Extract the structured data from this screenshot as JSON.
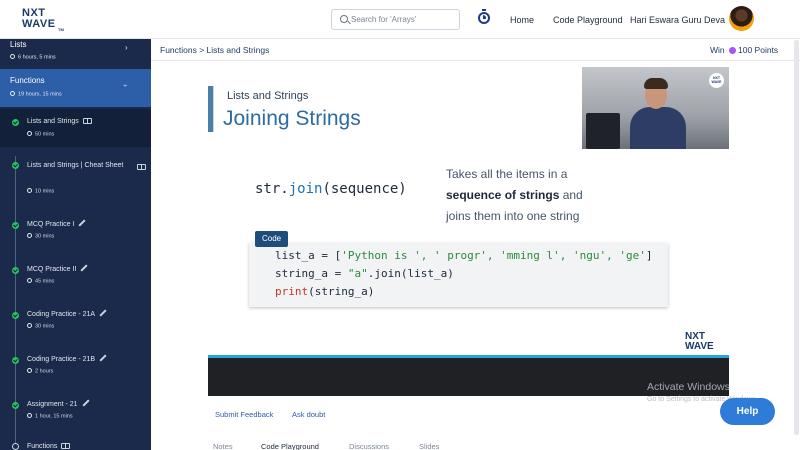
{
  "header": {
    "logo_line1": "NXT",
    "logo_line2": "WAVE",
    "logo_tm": "TM",
    "search_placeholder": "Search for 'Arrays'",
    "nav": [
      "Home",
      "Code Playground"
    ],
    "user_name": "Hari Eswara Guru Deva"
  },
  "sidebar": {
    "lists": {
      "title": "Lists",
      "meta": "6 hours, 5 mins"
    },
    "functions": {
      "title": "Functions",
      "meta": "19 hours, 15 mins"
    },
    "items": [
      {
        "title": "Lists and Strings",
        "meta": "50 mins",
        "icon": "book-icon"
      },
      {
        "title": "Lists and Strings | Cheat Sheet",
        "meta": "10 mins",
        "icon": "book-icon"
      },
      {
        "title": "MCQ Practice I",
        "meta": "30 mins",
        "icon": "pencil-icon"
      },
      {
        "title": "MCQ Practice II",
        "meta": "45 mins",
        "icon": "pencil-icon"
      },
      {
        "title": "Coding Practice - 21A",
        "meta": "30 mins",
        "icon": "pencil-icon"
      },
      {
        "title": "Coding Practice - 21B",
        "meta": "2 hours",
        "icon": "pencil-icon"
      },
      {
        "title": "Assignment - 21",
        "meta": "1 hour, 15 mins",
        "icon": "pencil-icon"
      },
      {
        "title": "Functions",
        "meta": "",
        "icon": "book-icon"
      }
    ]
  },
  "breadcrumb": "Functions > Lists and Strings",
  "rewards": {
    "win_label": "Win",
    "points": "100 Points"
  },
  "slide": {
    "subtitle": "Lists and Strings",
    "title": "Joining Strings",
    "syntax_obj": "str.",
    "syntax_fn": "join",
    "syntax_args": "(sequence)",
    "desc_1": "Takes all the items in a",
    "desc_bold": "sequence of strings",
    "desc_2": " and",
    "desc_3": "joins them into one string",
    "code_tag": "Code",
    "code_line1_a": "list_a = [",
    "code_line1_str": "'Python is ', ' progr', 'mming l', 'ngu', 'ge'",
    "code_line1_b": "]",
    "code_line2_a": "string_a = ",
    "code_line2_str": "\"a\"",
    "code_line2_b": ".join(list_a)",
    "code_line3_kw": "print",
    "code_line3_b": "(string_a)",
    "watermark_1": "NXT",
    "watermark_2": "WAVE"
  },
  "presenter_logo": "NXT WAVE",
  "actions": [
    "Submit Feedback",
    "Ask doubt"
  ],
  "tabs": [
    "Notes",
    "Code Playground",
    "Discussions",
    "Slides"
  ],
  "windows": {
    "title": "Activate Windows",
    "sub": "Go to Settings to activate Windows."
  },
  "help_label": "Help",
  "colors": {
    "sidebar": "#1b2a4a",
    "sidebar_active": "#2d5ea8",
    "check": "#22c55e",
    "accent": "#2f7bd8"
  }
}
